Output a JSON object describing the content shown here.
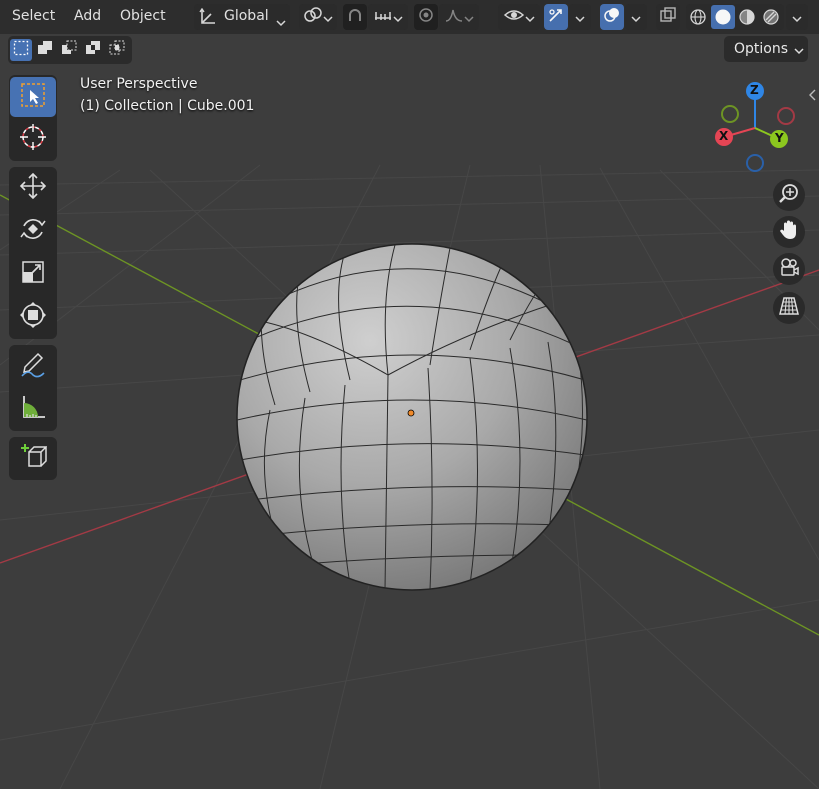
{
  "menus": [
    "Select",
    "Add",
    "Object"
  ],
  "header": {
    "transform_orientation": "Global",
    "options_label": "Options"
  },
  "viewport": {
    "view_name": "User Perspective",
    "collection_info": "(1) Collection | Cube.001"
  },
  "gizmo": {
    "z_label": "Z",
    "x_label": "X",
    "y_label": "Y"
  },
  "toolbar": {
    "tools": [
      "select-box",
      "cursor",
      "move",
      "rotate",
      "scale",
      "transform",
      "annotate",
      "measure",
      "add-cube"
    ],
    "active_tool": "select-box"
  },
  "select_modes": [
    "set",
    "extend",
    "subtract",
    "difference",
    "intersect"
  ],
  "colors": {
    "accent": "#4772b3",
    "axis_x": "#e54554",
    "axis_y": "#8cc71f",
    "axis_z": "#2f86e6",
    "background": "#3d3d3d"
  },
  "shading_modes": [
    "wireframe",
    "solid",
    "material-preview",
    "rendered"
  ],
  "active_shading": "solid"
}
